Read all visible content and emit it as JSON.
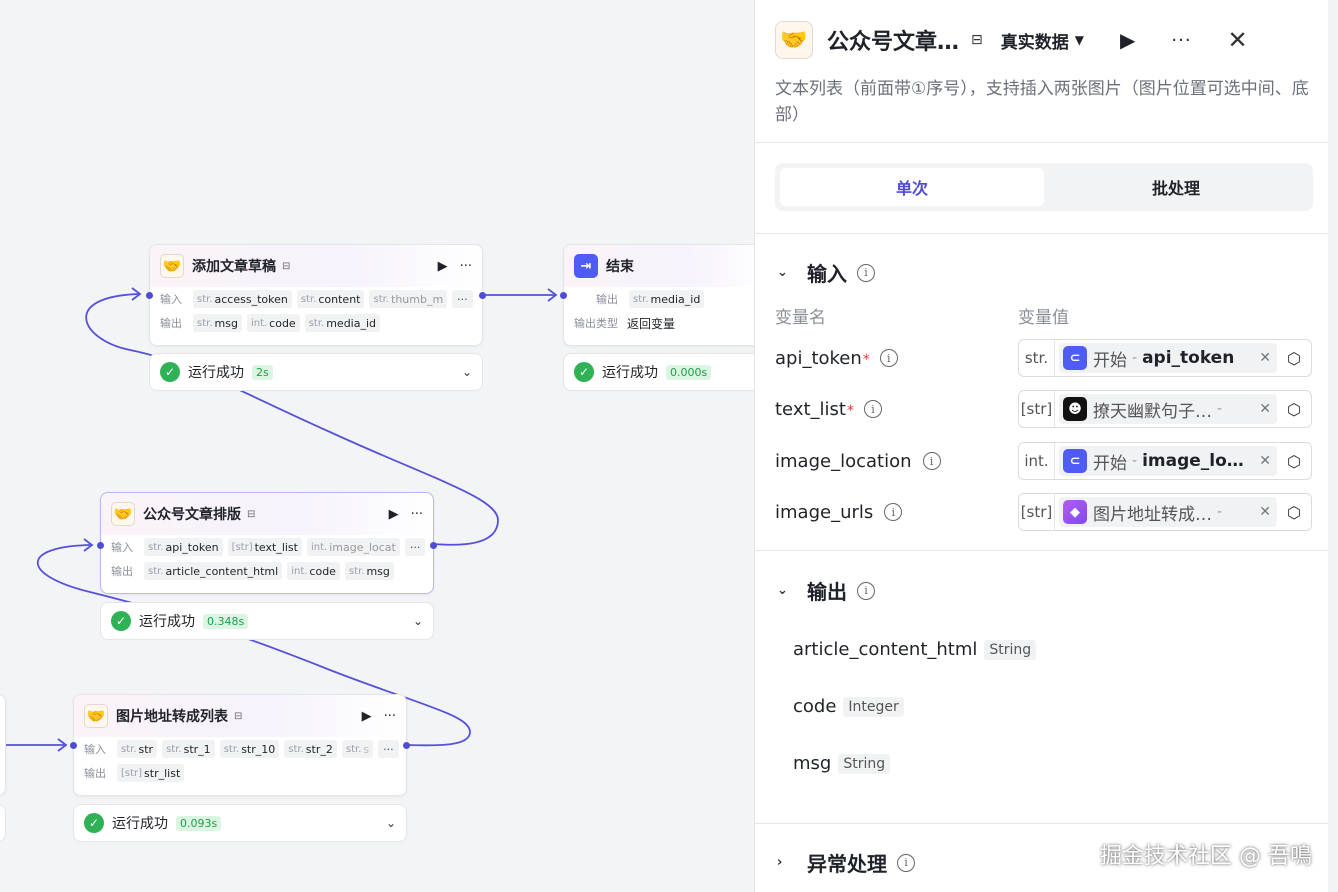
{
  "canvas": {
    "node_add_draft": {
      "title": "添加文章草稿",
      "in_label": "输入",
      "out_label": "输出",
      "inputs": [
        {
          "type": "str.",
          "name": "access_token"
        },
        {
          "type": "str.",
          "name": "content"
        },
        {
          "type": "str.",
          "name": "thumb_m"
        }
      ],
      "outputs": [
        {
          "type": "str.",
          "name": "msg"
        },
        {
          "type": "int.",
          "name": "code"
        },
        {
          "type": "str.",
          "name": "media_id"
        }
      ],
      "status": "运行成功",
      "duration": "2s"
    },
    "node_end": {
      "title": "结束",
      "out_label": "输出",
      "out_type_label": "输出类型",
      "outputs": [
        {
          "type": "str.",
          "name": "media_id"
        }
      ],
      "out_type_value": "返回变量",
      "status": "运行成功",
      "duration": "0.000s"
    },
    "node_layout": {
      "title": "公众号文章排版",
      "in_label": "输入",
      "out_label": "输出",
      "inputs": [
        {
          "type": "str.",
          "name": "api_token"
        },
        {
          "type": "[str]",
          "name": "text_list"
        },
        {
          "type": "int.",
          "name": "image_locat"
        }
      ],
      "outputs": [
        {
          "type": "str.",
          "name": "article_content_html"
        },
        {
          "type": "int.",
          "name": "code"
        },
        {
          "type": "str.",
          "name": "msg"
        }
      ],
      "status": "运行成功",
      "duration": "0.348s"
    },
    "node_image": {
      "title": "图片地址转成列表",
      "in_label": "输入",
      "out_label": "输出",
      "inputs": [
        {
          "type": "str.",
          "name": "str"
        },
        {
          "type": "str.",
          "name": "str_1"
        },
        {
          "type": "str.",
          "name": "str_10"
        },
        {
          "type": "str.",
          "name": "str_2"
        },
        {
          "type": "str.",
          "name": "s"
        }
      ],
      "outputs": [
        {
          "type": "[str]",
          "name": "str_list"
        }
      ],
      "status": "运行成功",
      "duration": "0.093s"
    },
    "more_label": "···"
  },
  "panel": {
    "title": "公众号文章…",
    "mode": "真实数据",
    "description": "文本列表（前面带①序号），支持插入两张图片（图片位置可选中间、底部）",
    "tabs": [
      {
        "label": "单次",
        "active": true
      },
      {
        "label": "批处理",
        "active": false
      }
    ],
    "input_section": "输入",
    "col_name": "变量名",
    "col_value": "变量值",
    "params": [
      {
        "name": "api_token",
        "required": "*",
        "type": "str.",
        "node": "开始",
        "var": "api_token"
      },
      {
        "name": "text_list",
        "required": "*",
        "type": "[str]",
        "node": "撩天幽默句子…",
        "var": ""
      },
      {
        "name": "image_location",
        "required": "",
        "type": "int.",
        "node": "开始",
        "var": "image_lo…"
      },
      {
        "name": "image_urls",
        "required": "",
        "type": "[str]",
        "node": "图片地址转成…",
        "var": ""
      }
    ],
    "output_section": "输出",
    "outputs": [
      {
        "name": "article_content_html",
        "type": "String"
      },
      {
        "name": "code",
        "type": "Integer"
      },
      {
        "name": "msg",
        "type": "String"
      }
    ],
    "exception_section": "异常处理"
  },
  "watermark": "掘金技术社区 @ 吾鳴",
  "colors": {
    "accent": "#4e4bd8",
    "success": "#2fb155",
    "wire": "#5552d9"
  }
}
